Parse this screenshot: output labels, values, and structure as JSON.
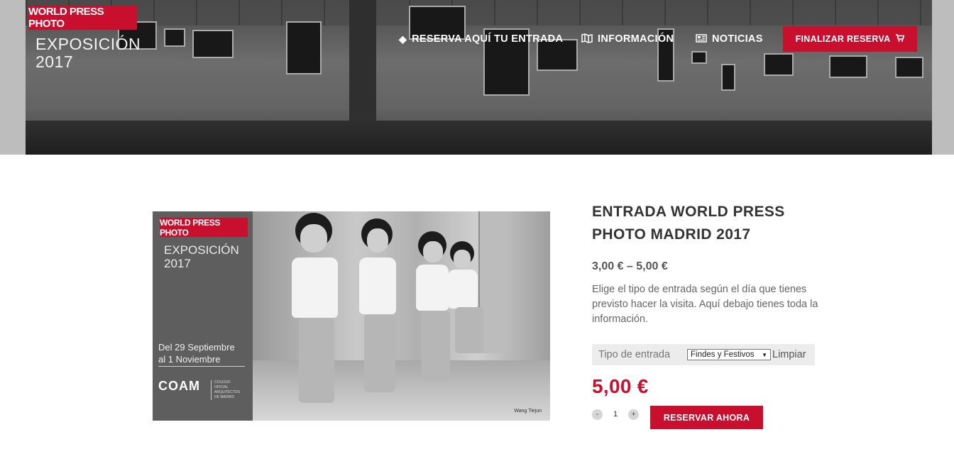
{
  "header": {
    "brand_badge": "WORLD PRESS PHOTO",
    "brand_line1": "EXPOSICIÓN",
    "brand_line2": "2017",
    "nav": [
      {
        "label": "RESERVA AQUÍ TU ENTRADA",
        "icon": "ticket-icon"
      },
      {
        "label": "INFORMACIÓN",
        "icon": "map-icon"
      },
      {
        "label": "NOTICIAS",
        "icon": "newspaper-icon"
      }
    ],
    "checkout_label": "FINALIZAR RESERVA",
    "checkout_icon": "cart-icon"
  },
  "product_image": {
    "badge": "WORLD PRESS PHOTO",
    "title_line1": "EXPOSICIÓN",
    "title_line2": "2017",
    "dates_line1": "Del 29 Septiembre",
    "dates_line2": "al 1 Noviembre",
    "org_name": "COAM",
    "org_sub_1": "COLEGIO",
    "org_sub_2": "OFICIAL",
    "org_sub_3": "ARQUITECTOS",
    "org_sub_4": "DE MADRID",
    "credit": "Wang Tiejun"
  },
  "product": {
    "title": "ENTRADA WORLD PRESS PHOTO MADRID 2017",
    "price_range": "3,00 € – 5,00 €",
    "description": "Elige el tipo de entrada según el día que tienes previsto hacer la visita. Aquí debajo tienes toda la información.",
    "variation_label": "Tipo de entrada",
    "variation_selected": "Findes y Festivos",
    "clear_label": "Limpiar",
    "price": "5,00 €",
    "qty_minus": "-",
    "qty_value": "1",
    "qty_plus": "+",
    "reserve_label": "RESERVAR AHORA"
  },
  "colors": {
    "accent": "#c8102e",
    "text": "#333333"
  }
}
